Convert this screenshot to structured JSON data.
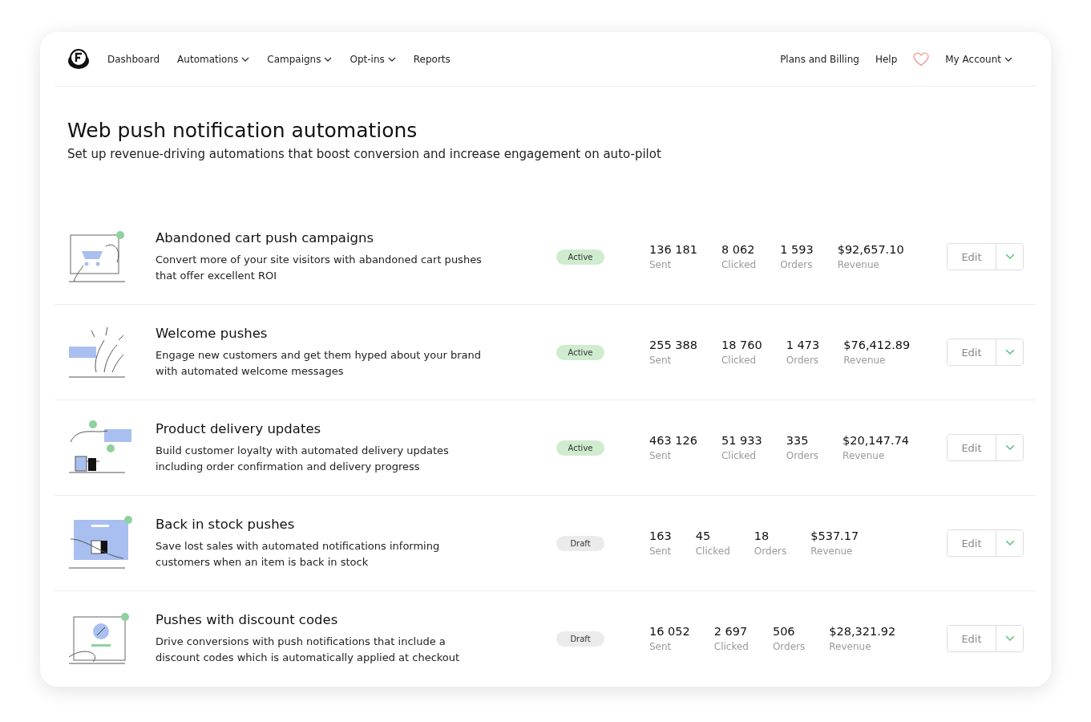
{
  "nav": {
    "left": [
      {
        "label": "Dashboard",
        "has_menu": false
      },
      {
        "label": "Automations",
        "has_menu": true
      },
      {
        "label": "Campaigns",
        "has_menu": true
      },
      {
        "label": "Opt-ins",
        "has_menu": true
      },
      {
        "label": "Reports",
        "has_menu": false
      }
    ],
    "right": [
      {
        "label": "Plans and Billing",
        "kind": "link"
      },
      {
        "label": "Help",
        "kind": "link"
      },
      {
        "kind": "heart"
      },
      {
        "label": "My Account",
        "kind": "menu"
      }
    ]
  },
  "page": {
    "title": "Web push notification automations",
    "subtitle": "Set up revenue-driving automations that boost conversion and increase engagement on auto-pilot"
  },
  "automations": [
    {
      "kind": "cart",
      "title": "Abandoned cart push campaigns",
      "description": "Convert more of your site visitors with abandoned cart pushes that offer excellent ROI",
      "status": {
        "kind": "active",
        "label": "Active"
      },
      "stats": [
        {
          "value": "136 181",
          "label": "Sent"
        },
        {
          "value": "8 062",
          "label": "Clicked"
        },
        {
          "value": "1 593",
          "label": "Orders"
        },
        {
          "value": "$92,657.10",
          "label": "Revenue"
        }
      ],
      "action": "Edit"
    },
    {
      "kind": "welcome",
      "title": "Welcome pushes",
      "description": "Engage new customers and get them hyped about your brand with automated welcome messages",
      "status": {
        "kind": "active",
        "label": "Active"
      },
      "stats": [
        {
          "value": "255 388",
          "label": "Sent"
        },
        {
          "value": "18 760",
          "label": "Clicked"
        },
        {
          "value": "1 473",
          "label": "Orders"
        },
        {
          "value": "$76,412.89",
          "label": "Revenue"
        }
      ],
      "action": "Edit"
    },
    {
      "kind": "delivery",
      "title": "Product delivery updates",
      "description": "Build customer loyalty with automated delivery updates including order confirmation and delivery progress",
      "status": {
        "kind": "active",
        "label": "Active"
      },
      "stats": [
        {
          "value": "463 126",
          "label": "Sent"
        },
        {
          "value": "51 933",
          "label": "Clicked"
        },
        {
          "value": "335",
          "label": "Orders"
        },
        {
          "value": "$20,147.74",
          "label": "Revenue"
        }
      ],
      "action": "Edit"
    },
    {
      "kind": "stock",
      "title": "Back in stock pushes",
      "description": "Save lost sales with automated notifications informing customers when an item is back in stock",
      "status": {
        "kind": "draft",
        "label": "Draft"
      },
      "stats": [
        {
          "value": "163",
          "label": "Sent"
        },
        {
          "value": "45",
          "label": "Clicked"
        },
        {
          "value": "18",
          "label": "Orders"
        },
        {
          "value": "$537.17",
          "label": "Revenue"
        }
      ],
      "action": "Edit"
    },
    {
      "kind": "discount",
      "title": "Pushes with discount codes",
      "description": "Drive conversions with push notifications that include a discount codes which is automatically applied at checkout",
      "status": {
        "kind": "draft",
        "label": "Draft"
      },
      "stats": [
        {
          "value": "16 052",
          "label": "Sent"
        },
        {
          "value": "2 697",
          "label": "Clicked"
        },
        {
          "value": "506",
          "label": "Orders"
        },
        {
          "value": "$28,321.92",
          "label": "Revenue"
        }
      ],
      "action": "Edit"
    }
  ]
}
